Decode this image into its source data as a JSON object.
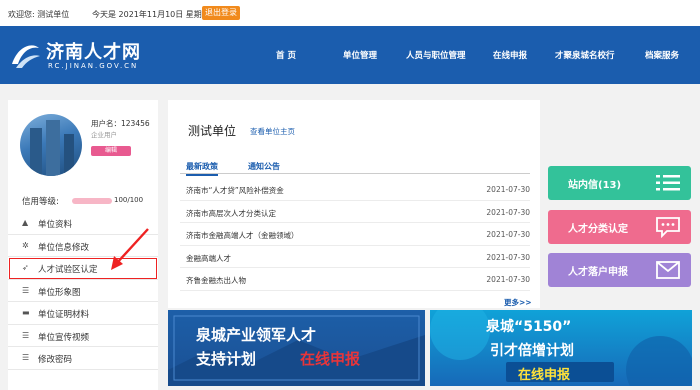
{
  "topbar": {
    "welcome": "欢迎您: 测试单位",
    "today": "今天是 2021年11月10日 星期三",
    "logout": "退出登录"
  },
  "logo": {
    "cn": "济南人才网",
    "en": "RC.JINAN.GOV.CN"
  },
  "nav": [
    "首 页",
    "单位管理",
    "人员与职位管理",
    "在线申报",
    "才聚泉城名校行",
    "档案服务"
  ],
  "profile": {
    "username": "用户名：123456",
    "usertype": "企业用户",
    "edit": "编辑",
    "credit_label": "信用等级:",
    "credit_value": "100/100",
    "credit_fraction": 1.0
  },
  "menu": [
    {
      "icon": "building-icon",
      "glyph": "▲",
      "label": "单位资料"
    },
    {
      "icon": "gear-icon",
      "glyph": "✲",
      "label": "单位信息修改"
    },
    {
      "icon": "rocket-icon",
      "glyph": "➶",
      "label": "人才试验区认定",
      "highlight": true
    },
    {
      "icon": "list-icon",
      "glyph": "☰",
      "label": "单位形象图"
    },
    {
      "icon": "folder-icon",
      "glyph": "▬",
      "label": "单位证明材料"
    },
    {
      "icon": "list-icon",
      "glyph": "☰",
      "label": "单位宣传视频"
    },
    {
      "icon": "list-icon",
      "glyph": "☰",
      "label": "修改密码"
    }
  ],
  "main": {
    "title": "测试单位",
    "home_link": "查看单位主页",
    "tabs": [
      "最新政策",
      "通知公告"
    ],
    "news": [
      {
        "title": "济南市“人才贷”风险补偿资金",
        "date": "2021-07-30"
      },
      {
        "title": "济南市高层次人才分类认定",
        "date": "2021-07-30"
      },
      {
        "title": "济南市金融高端人才（金融领域）",
        "date": "2021-07-30"
      },
      {
        "title": "金融高端人才",
        "date": "2021-07-30"
      },
      {
        "title": "齐鲁金融杰出人物",
        "date": "2021-07-30"
      }
    ],
    "more": "更多>>"
  },
  "side": [
    {
      "label": "站内信(13)",
      "color": "#33c29a",
      "icon": "grid-list-icon"
    },
    {
      "label": "人才分类认定",
      "color": "#ef6b8e",
      "icon": "chat-icon"
    },
    {
      "label": "人才落户申报",
      "color": "#a083d6",
      "icon": "mail-icon"
    }
  ],
  "banners": {
    "left": {
      "line1": "泉城产业领军人才",
      "line2a": "支持计划",
      "line2b": "在线申报"
    },
    "right": {
      "line1": "泉城“5150”",
      "line2": "引才倍增计划",
      "line3": "在线申报"
    }
  }
}
